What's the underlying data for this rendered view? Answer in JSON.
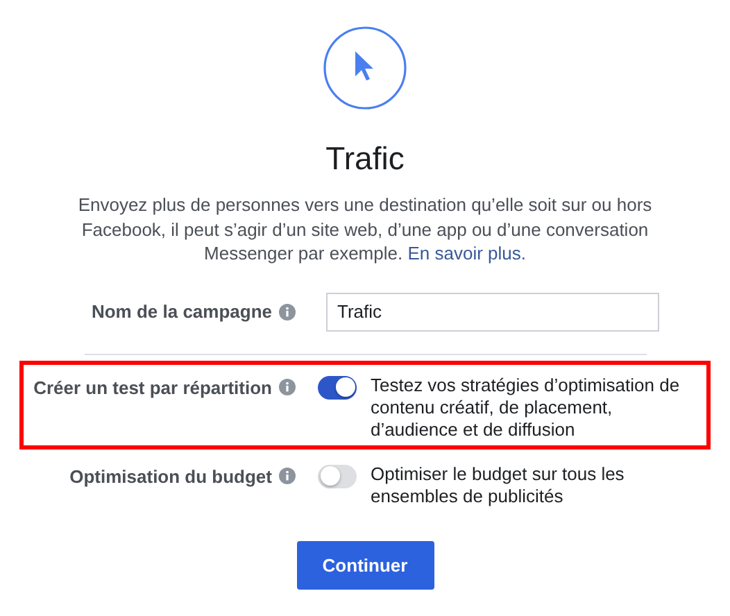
{
  "title": "Trafic",
  "description": "Envoyez plus de personnes vers une destination qu’elle soit sur ou hors Facebook, il peut s’agir d’un site web, d’une app ou d’une conversation Messenger par exemple.",
  "learn_more_link": "En savoir plus.",
  "campaign_name": {
    "label": "Nom de la campagne",
    "value": "Trafic"
  },
  "options": [
    {
      "label": "Créer un test par répartition",
      "on": true,
      "highlighted": true,
      "description": "Testez vos stratégies d’optimisation de contenu créatif, de placement, d’audience et de diffusion"
    },
    {
      "label": "Optimisation du budget",
      "on": false,
      "highlighted": false,
      "description": "Optimiser le budget sur tous les ensembles de publicités"
    }
  ],
  "continue_button": "Continuer"
}
